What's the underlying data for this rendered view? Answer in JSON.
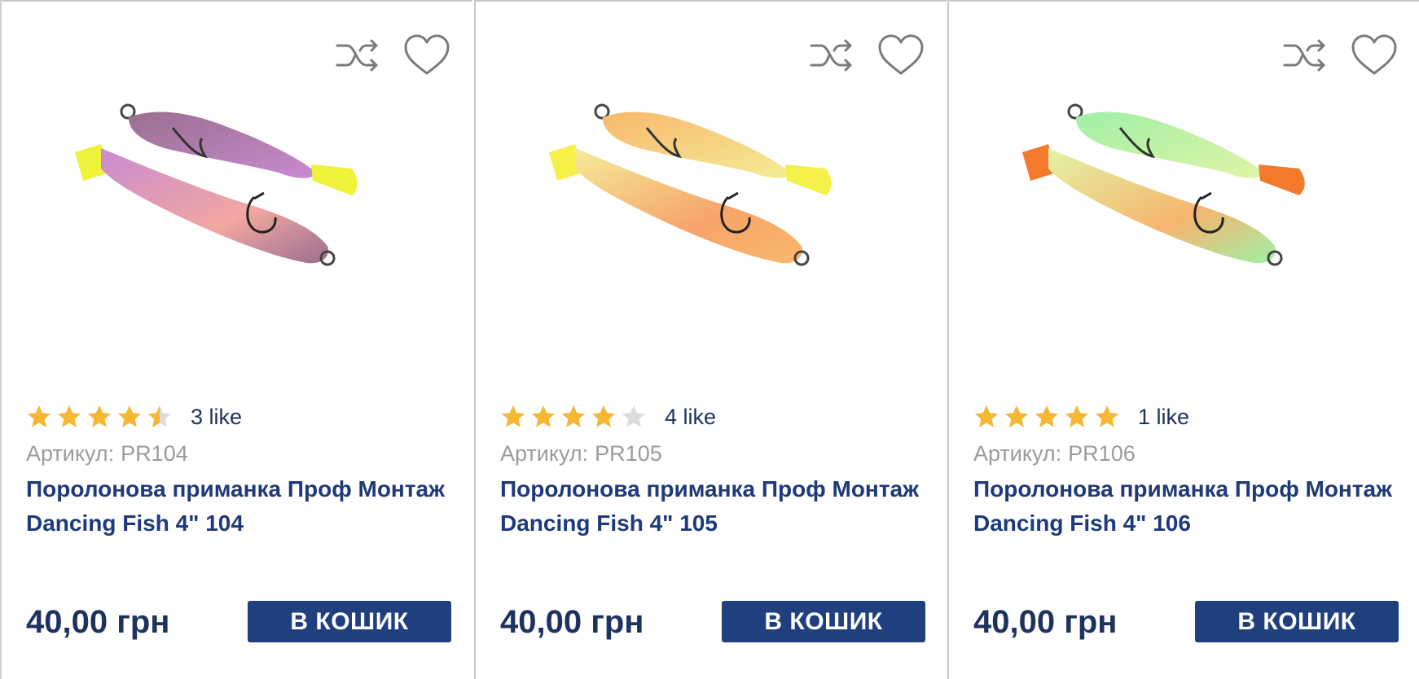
{
  "products": [
    {
      "rating_stars": 4.5,
      "like_count": "3 like",
      "sku_label": "Артикул:",
      "sku": "PR104",
      "title": "Поролонова приманка Проф Монтаж Dancing Fish 4\" 104",
      "price": "40,00 грн",
      "buy_label": "В КОШИК",
      "colors": {
        "body_top": "#9a6f8f",
        "body_bottom": "#c98bd0",
        "belly": "#f2a7a0",
        "tail": "#eef33a",
        "accent": "#7c5a80"
      }
    },
    {
      "rating_stars": 4,
      "like_count": "4 like",
      "sku_label": "Артикул:",
      "sku": "PR105",
      "title": "Поролонова приманка Проф Монтаж Dancing Fish 4\" 105",
      "price": "40,00 грн",
      "buy_label": "В КОШИК",
      "colors": {
        "body_top": "#f8b86c",
        "body_bottom": "#f4ec98",
        "belly": "#f7a46a",
        "tail": "#f5f04a",
        "accent": "#f7c590"
      }
    },
    {
      "rating_stars": 5,
      "like_count": "1 like",
      "sku_label": "Артикул:",
      "sku": "PR106",
      "title": "Поролонова приманка Проф Монтаж Dancing Fish 4\" 106",
      "price": "40,00 грн",
      "buy_label": "В КОШИК",
      "colors": {
        "body_top": "#9ff0a6",
        "body_bottom": "#e2f3a6",
        "belly": "#f6b56e",
        "tail": "#f37a2c",
        "accent": "#c6f09d"
      }
    }
  ],
  "icons": {
    "compare": "shuffle-compare-icon",
    "wishlist": "heart-icon"
  },
  "theme": {
    "star_on": "#f7b733",
    "star_off": "#dcdcdc",
    "button_bg": "#1f3f7f"
  }
}
